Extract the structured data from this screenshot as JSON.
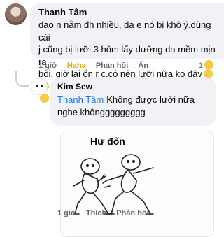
{
  "comment": {
    "author": "Thanh Tâm",
    "text_line1": "dạo n nằm đh nhiều, da e nó bị khô ý.dùng cái",
    "text_line2": "j cũng bị lưỡi.3 hôm lấy dưỡng da mềm mịn ra",
    "text_line3": "bôi, giờ lại ổn r c.có nên lưỡi nữa ko đây",
    "time": "1 giờ",
    "reaction_label": "Haha",
    "reply_label": "Phản hồi",
    "hide_label": "Ẩn",
    "reaction_count": "1"
  },
  "reply": {
    "author": "Kim Sew",
    "mention": "Thanh Tâm",
    "text": "Không được lười nữa nghe khônggggggggg",
    "sticker_caption": "Hư đốn",
    "time": "1 giờ",
    "like_label": "Thích",
    "reply_label": "Phản hồi"
  },
  "colors": {
    "bubble": "#f0f2f5",
    "mention": "#1877f2",
    "haha": "#e3a400",
    "meta": "#65676b"
  }
}
